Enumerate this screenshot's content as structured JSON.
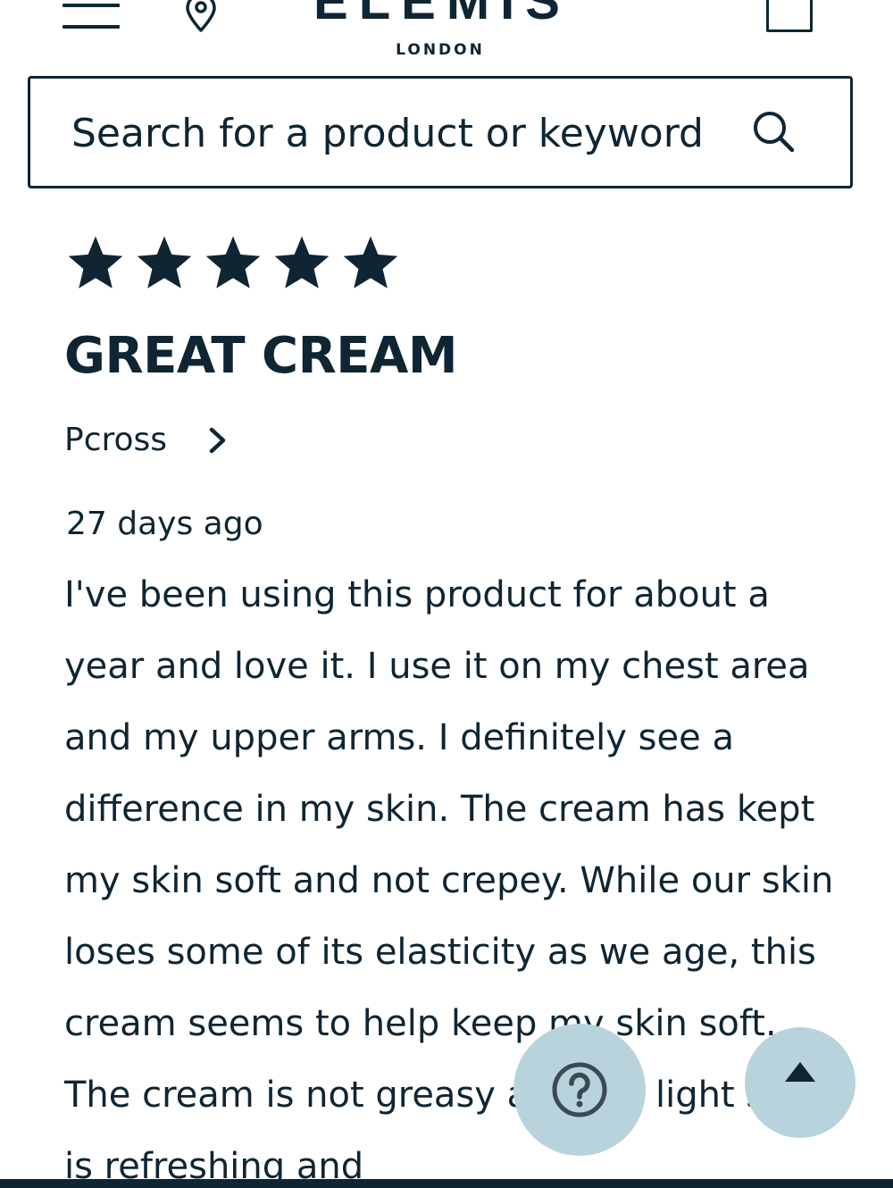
{
  "header": {
    "logo_text": "ELEMIS",
    "logo_subtitle": "LONDON",
    "menu_icon": "hamburger-menu-icon",
    "store_icon": "location-pin-icon",
    "bag_icon": "shopping-bag-icon"
  },
  "search": {
    "placeholder": "Search for a product or keyword",
    "icon": "search-icon"
  },
  "review": {
    "rating": 5,
    "rating_max": 5,
    "title": "GREAT CREAM",
    "reviewer": "Pcross",
    "date": "27 days ago",
    "body": "I've been using this product for about a year and love it. I use it on my chest area and my upper arms. I definitely see a difference in my skin. The cream has kept my skin soft and not crepey. While our skin loses some of its elasticity as we age, this cream seems to help keep my skin soft. The cream is not greasy and the light scent is refreshing and"
  },
  "floating": {
    "help_icon": "question-mark-icon",
    "top_icon": "arrow-up-icon"
  },
  "colors": {
    "ink": "#0f2533",
    "floating_button": "#b9d3dd",
    "background": "#ffffff"
  }
}
